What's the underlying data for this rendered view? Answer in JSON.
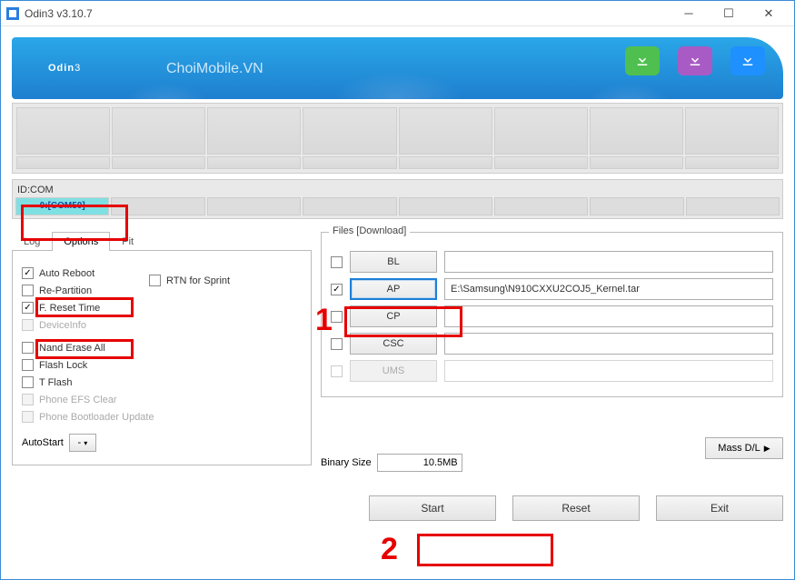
{
  "window": {
    "title": "Odin3 v3.10.7"
  },
  "banner": {
    "logo_strong": "Odin",
    "logo_light": "3",
    "subtitle": "ChoiMobile.VN"
  },
  "idcom": {
    "label": "ID:COM",
    "value": "0:[COM50]"
  },
  "tabs": {
    "log": "Log",
    "options": "Options",
    "pit": "Pit"
  },
  "options": {
    "auto_reboot": "Auto Reboot",
    "re_partition": "Re-Partition",
    "f_reset_time": "F. Reset Time",
    "device_info": "DeviceInfo",
    "nand_erase": "Nand Erase All",
    "flash_lock": "Flash Lock",
    "t_flash": "T Flash",
    "efs_clear": "Phone EFS Clear",
    "bootloader_update": "Phone Bootloader Update",
    "rtn_sprint": "RTN for Sprint",
    "autostart_label": "AutoStart",
    "autostart_value": "-"
  },
  "files": {
    "legend": "Files [Download]",
    "bl": "BL",
    "ap": "AP",
    "cp": "CP",
    "csc": "CSC",
    "ums": "UMS",
    "ap_path": "E:\\Samsung\\N910CXXU2COJ5_Kernel.tar"
  },
  "binary": {
    "label": "Binary Size",
    "value": "10.5MB"
  },
  "buttons": {
    "massdl": "Mass D/L",
    "start": "Start",
    "reset": "Reset",
    "exit": "Exit"
  },
  "annotations": {
    "one": "1",
    "two": "2"
  }
}
